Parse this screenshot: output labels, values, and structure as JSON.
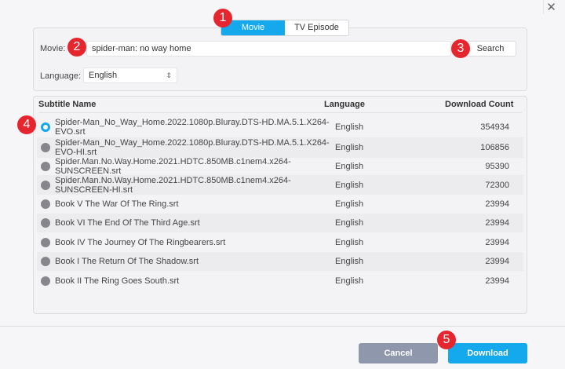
{
  "tabs": [
    {
      "label": "Movie",
      "active": true
    },
    {
      "label": "TV Episode",
      "active": false
    }
  ],
  "search": {
    "movie_label": "Movie:",
    "movie_value": "spider-man: no way home",
    "search_button": "Search",
    "language_label": "Language:",
    "language_value": "English"
  },
  "table": {
    "headers": [
      "Subtitle Name",
      "Language",
      "Download Count"
    ],
    "rows": [
      {
        "name": "Spider-Man_No_Way_Home.2022.1080p.Bluray.DTS-HD.MA.5.1.X264-EVO.srt",
        "language": "English",
        "count": "354934",
        "selected": true
      },
      {
        "name": "Spider-Man_No_Way_Home.2022.1080p.Bluray.DTS-HD.MA.5.1.X264-EVO-HI.srt",
        "language": "English",
        "count": "106856"
      },
      {
        "name": "Spider.Man.No.Way.Home.2021.HDTC.850MB.c1nem4.x264-SUNSCREEN.srt",
        "language": "English",
        "count": "95390"
      },
      {
        "name": "Spider.Man.No.Way.Home.2021.HDTC.850MB.c1nem4.x264-SUNSCREEN-HI.srt",
        "language": "English",
        "count": "72300"
      },
      {
        "name": "Book V The War Of The Ring.srt",
        "language": "English",
        "count": "23994"
      },
      {
        "name": "Book VI The End Of The Third Age.srt",
        "language": "English",
        "count": "23994"
      },
      {
        "name": "Book IV The Journey Of The Ringbearers.srt",
        "language": "English",
        "count": "23994"
      },
      {
        "name": "Book I The Return Of The Shadow.srt",
        "language": "English",
        "count": "23994"
      },
      {
        "name": "Book II The Ring Goes South.srt",
        "language": "English",
        "count": "23994"
      }
    ]
  },
  "footer": {
    "cancel": "Cancel",
    "download": "Download"
  },
  "badges": [
    "1",
    "2",
    "3",
    "4",
    "5"
  ],
  "colors": {
    "accent": "#14a8ec",
    "badge": "#e5262e",
    "cancel": "#8e97ab"
  }
}
